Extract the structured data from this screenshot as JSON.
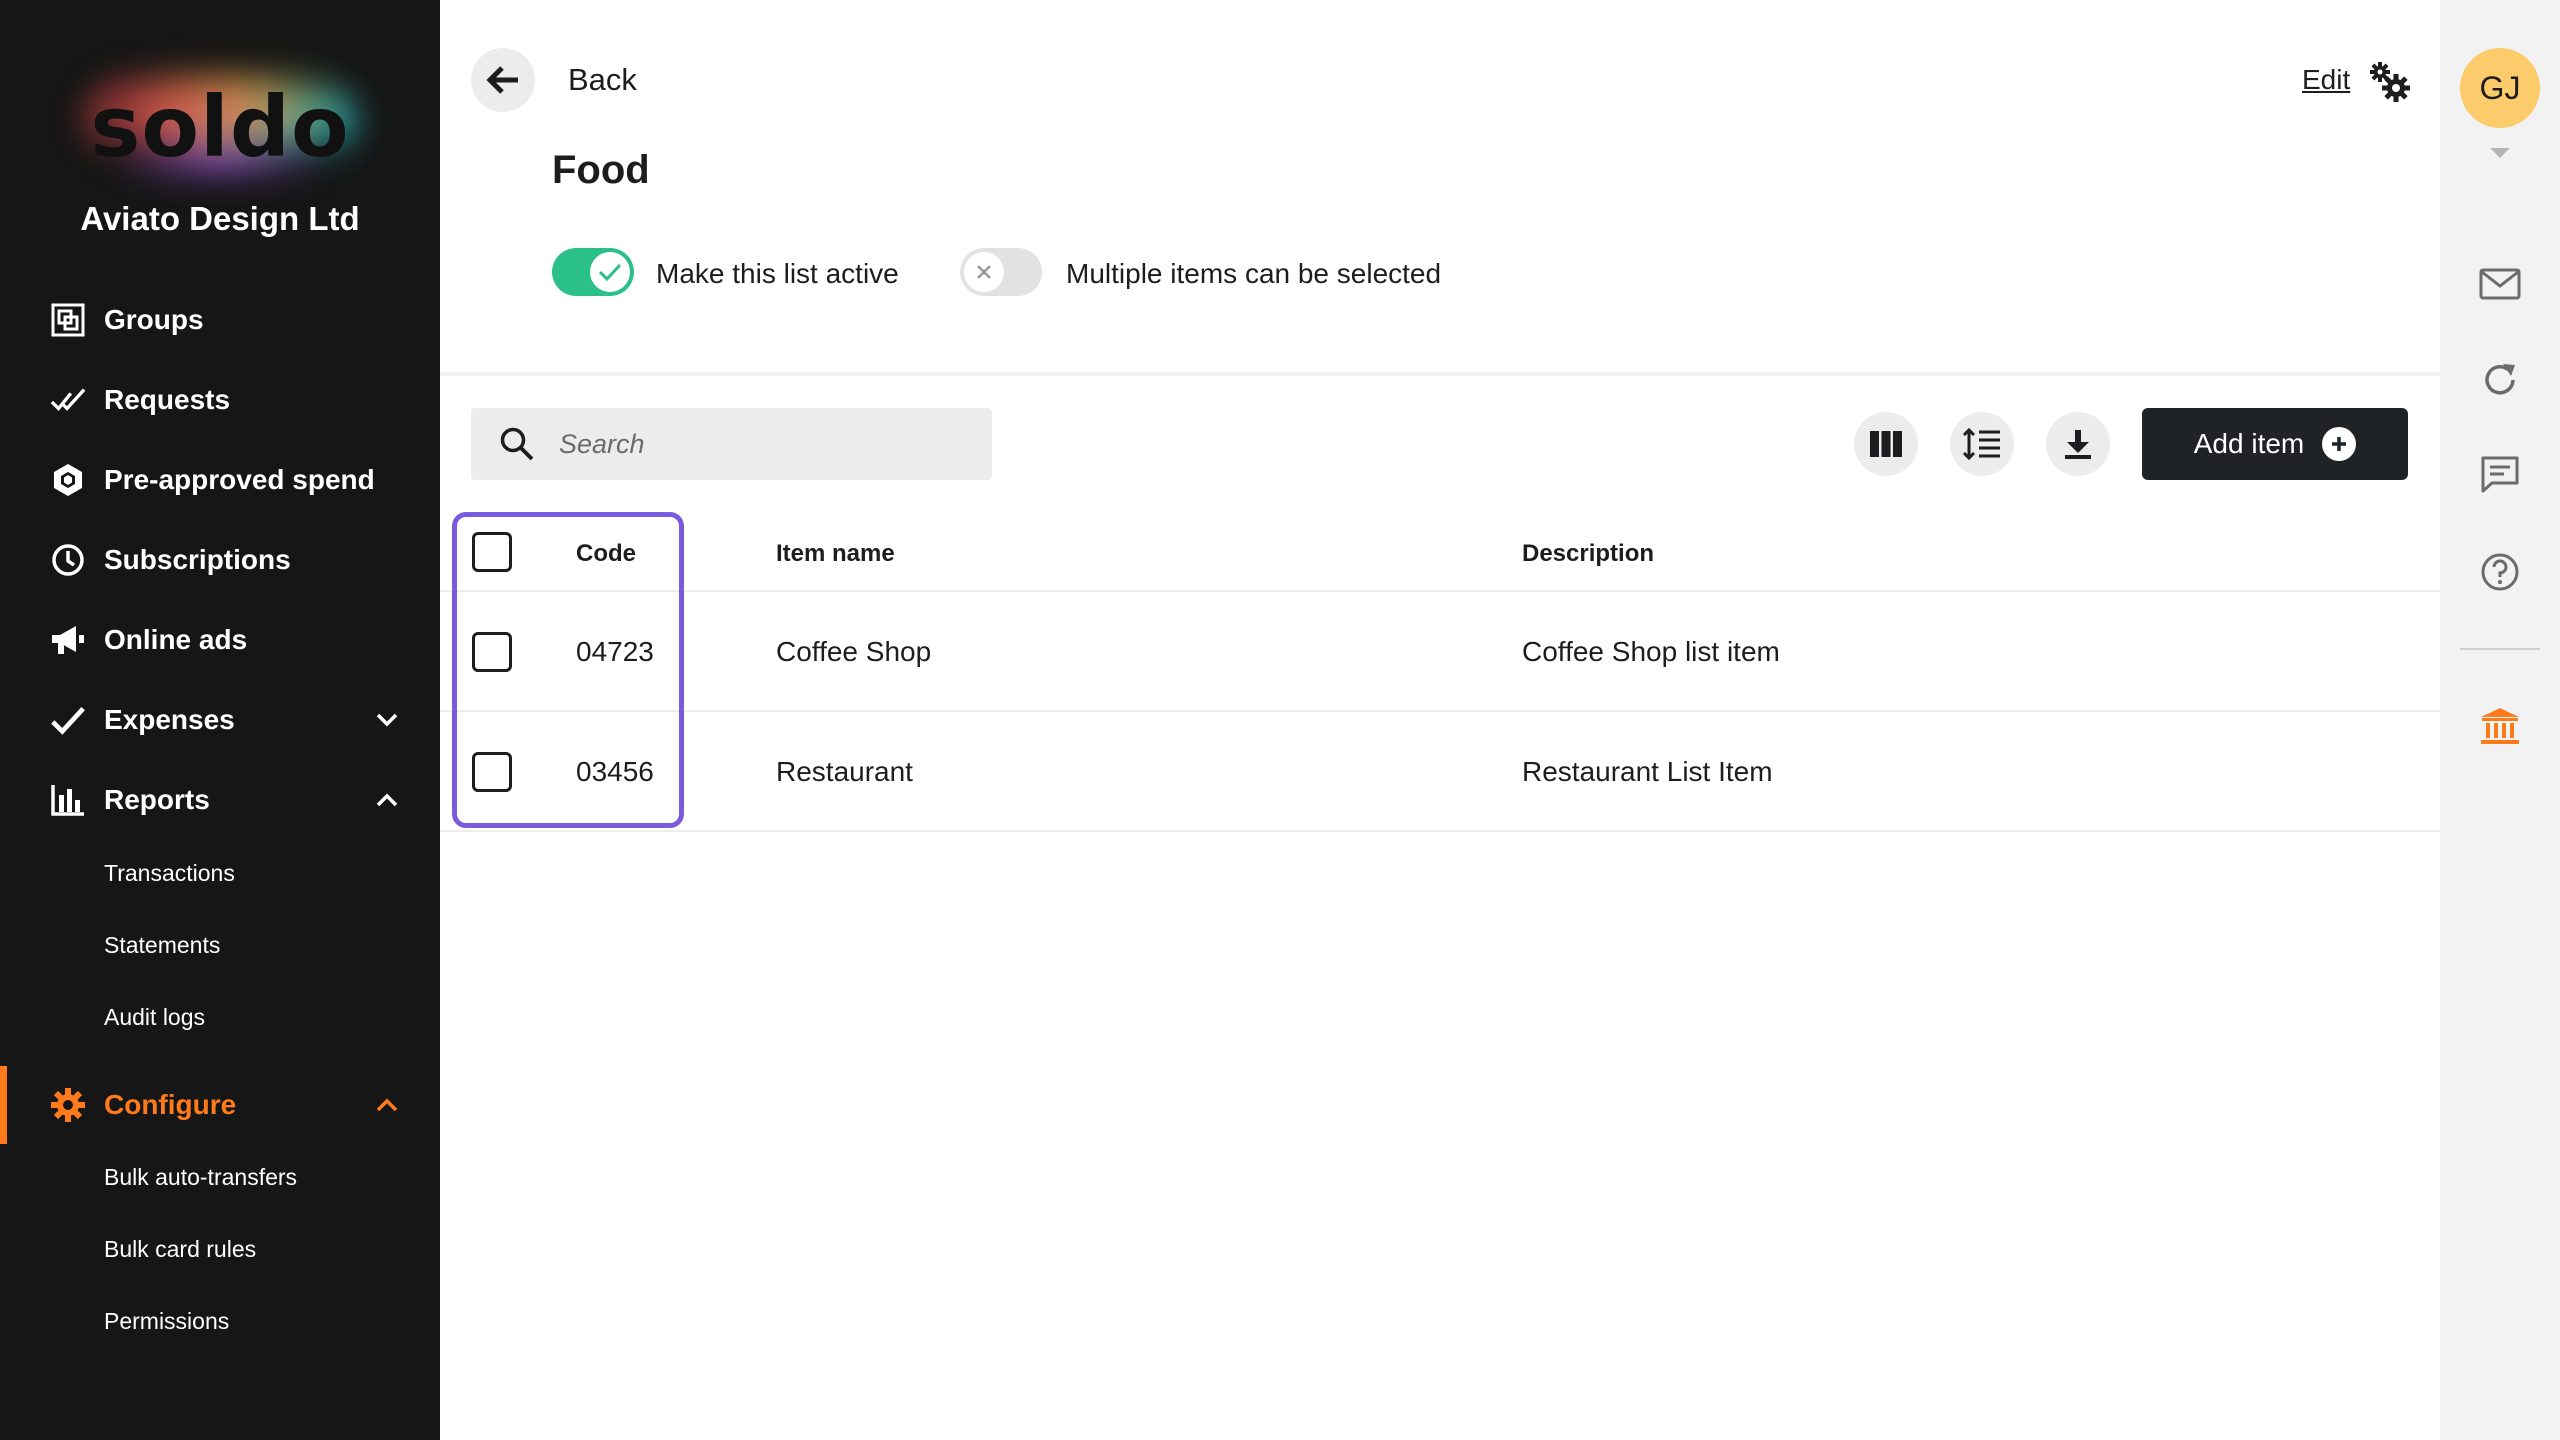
{
  "sidebar": {
    "logo_text": "soldo",
    "company": "Aviato Design Ltd",
    "items": [
      {
        "label": "Groups",
        "icon": "groups-icon"
      },
      {
        "label": "Requests",
        "icon": "double-check-icon"
      },
      {
        "label": "Pre-approved spend",
        "icon": "hexagon-icon"
      },
      {
        "label": "Subscriptions",
        "icon": "clock-icon"
      },
      {
        "label": "Online ads",
        "icon": "megaphone-icon"
      },
      {
        "label": "Expenses",
        "icon": "check-icon",
        "expanded": false
      },
      {
        "label": "Reports",
        "icon": "bar-chart-icon",
        "expanded": true
      },
      {
        "label": "Configure",
        "icon": "gear-icon",
        "expanded": true,
        "active": true
      }
    ],
    "reports_sub": [
      "Transactions",
      "Statements",
      "Audit logs"
    ],
    "configure_sub": [
      "Bulk auto-transfers",
      "Bulk card rules",
      "Permissions"
    ],
    "accent_color": "#ff7a1a"
  },
  "header": {
    "back_label": "Back",
    "edit_label": "Edit",
    "title": "Food"
  },
  "toggles": {
    "active": {
      "label": "Make this list active",
      "on": true
    },
    "multi": {
      "label": "Multiple items can be selected",
      "on": false
    }
  },
  "toolbar": {
    "search_placeholder": "Search",
    "add_item_label": "Add item"
  },
  "table": {
    "columns": [
      "Code",
      "Item name",
      "Description"
    ],
    "rows": [
      {
        "code": "04723",
        "name": "Coffee Shop",
        "description": "Coffee Shop list item"
      },
      {
        "code": "03456",
        "name": "Restaurant",
        "description": "Restaurant List Item"
      }
    ]
  },
  "user": {
    "initials": "GJ"
  },
  "colors": {
    "toggle_on": "#2bbf8a",
    "highlight": "#7a5bde",
    "primary_button": "#1f2326",
    "avatar": "#fccb6b"
  }
}
